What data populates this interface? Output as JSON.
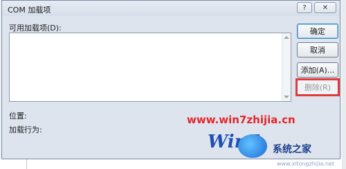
{
  "window": {
    "title": "COM 加载项",
    "help_label": "?",
    "close_label": "✕"
  },
  "available_addins": {
    "label": "可用加载项(D):",
    "items": []
  },
  "buttons": {
    "ok": "确定",
    "cancel": "取消",
    "add": "添加(A)...",
    "remove": "删除(R)"
  },
  "details": {
    "location_label": "位置:",
    "load_behavior_label": "加载行为:"
  },
  "watermark": {
    "url": "www.win7zhijia.cn",
    "brand_logo": "Win7",
    "brand_text": "系统之家",
    "small_url": "www.xitongzhijia.net"
  },
  "colors": {
    "highlight": "#e03a3a",
    "dialog_bg": "#dde4ee",
    "watermark_red": "#e5262a"
  }
}
